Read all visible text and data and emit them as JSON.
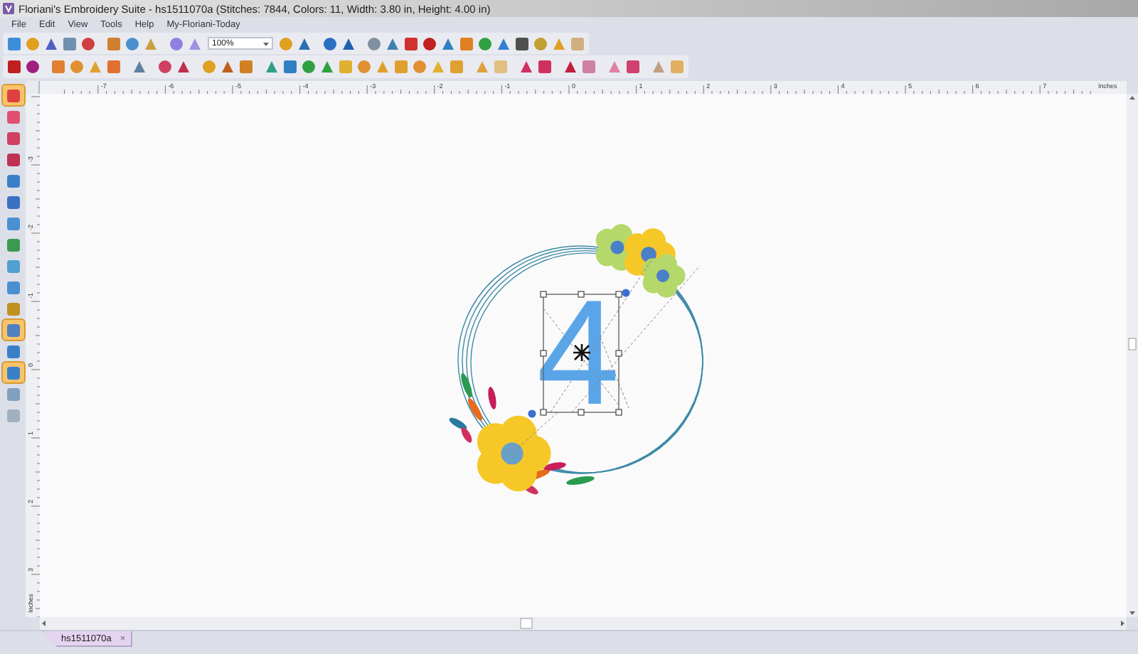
{
  "window": {
    "title": "Floriani's Embroidery Suite - hs1511070a (Stitches: 7844, Colors: 11, Width: 3.80 in, Height: 4.00 in)"
  },
  "menu": [
    "File",
    "Edit",
    "View",
    "Tools",
    "Help",
    "My-Floriani-Today"
  ],
  "toolbar": {
    "zoom": "100%"
  },
  "toolbox": [
    {
      "selected": true
    },
    {
      "selected": false
    },
    {
      "selected": false
    },
    {
      "selected": false
    },
    {
      "selected": false
    },
    {
      "selected": false
    },
    {
      "selected": false
    },
    {
      "selected": false
    },
    {
      "selected": false
    },
    {
      "selected": false
    },
    {
      "selected": false
    },
    {
      "selected": true
    },
    {
      "selected": false
    },
    {
      "selected": true
    },
    {
      "selected": false
    },
    {
      "selected": false
    }
  ],
  "rulers": {
    "horizontal": {
      "labels": [
        "-7",
        "-6",
        "-5",
        "-4",
        "-3",
        "-2",
        "-1",
        "0",
        "1",
        "2",
        "3",
        "4",
        "5",
        "6",
        "7"
      ],
      "unit": "Inches"
    },
    "vertical": {
      "labels": [
        "-3",
        "-2",
        "-1",
        "0",
        "1",
        "2",
        "3"
      ],
      "unit": "Inches"
    }
  },
  "design": {
    "text": "4"
  },
  "tabs": [
    {
      "label": "hs1511070a",
      "close": "×",
      "selected": true
    }
  ]
}
